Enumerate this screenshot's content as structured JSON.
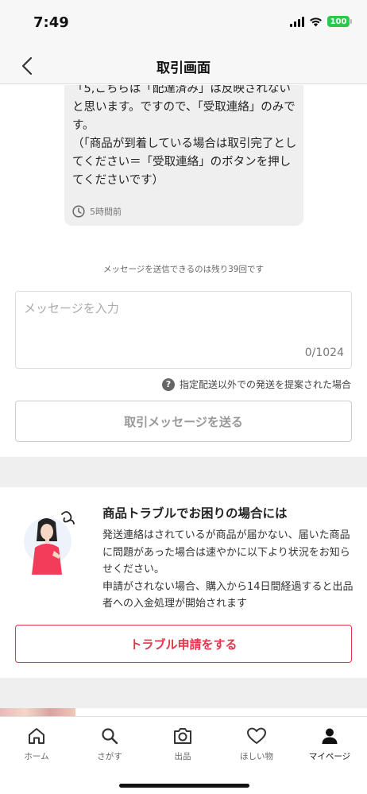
{
  "status_bar": {
    "time": "7:49",
    "battery": "100",
    "battery_color": "#2dc74a"
  },
  "header": {
    "title": "取引画面",
    "back_icon": "chevron-left-icon"
  },
  "chat": {
    "message_text": "「5,こちらは「配達済み」は反映されないと思います。ですので、「受取連絡」のみです。\n（「商品が到着している場合は取引完了としてください＝「受取連絡」のボタンを押してくださいです）",
    "timestamp": "5時間前",
    "time_icon": "clock-icon"
  },
  "message_form": {
    "remaining_note": "メッセージを送信できるのは残り39回です",
    "placeholder": "メッセージを入力",
    "value": "",
    "counter": "0/1024",
    "help_link": "指定配送以外での発送を提案された場合",
    "help_icon": "question-circle-icon",
    "send_button": "取引メッセージを送る"
  },
  "trouble": {
    "title": "商品トラブルでお困りの場合には",
    "description": "発送連絡はされているが商品が届かない、届いた商品に問題があった場合は速やかに以下より状況をお知らせください。\n申請がされない場合、購入から14日間経過すると出品者への入金処理が開始されます",
    "button": "トラブル申請をする",
    "accent_color": "#e4354a"
  },
  "tab_bar": {
    "items": [
      {
        "label": "ホーム",
        "icon": "home-icon"
      },
      {
        "label": "さがす",
        "icon": "search-icon"
      },
      {
        "label": "出品",
        "icon": "camera-icon"
      },
      {
        "label": "ほしい物",
        "icon": "heart-icon"
      },
      {
        "label": "マイページ",
        "icon": "person-icon",
        "active": true
      }
    ]
  }
}
